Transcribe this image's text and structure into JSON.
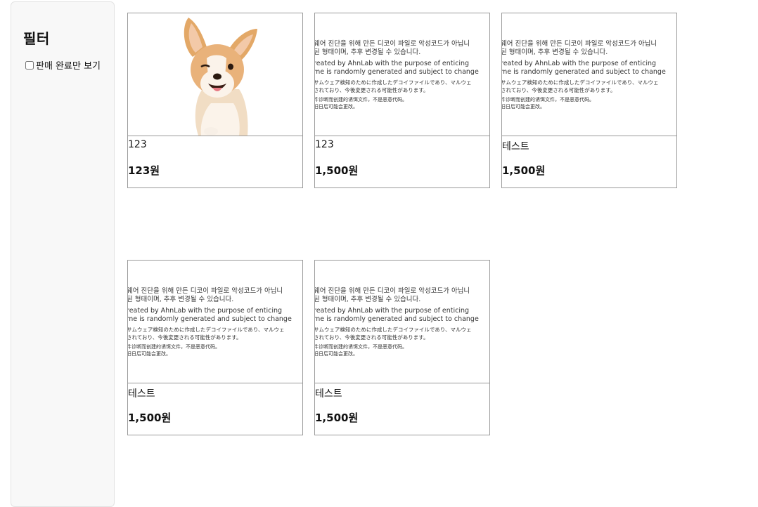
{
  "sidebar": {
    "title": "필터",
    "sold_only_label": "판매 완료만 보기",
    "sold_only_checked": false
  },
  "decoy": {
    "line1a": "웨어 진단을 위해 만든 디코이 파일로 악성코드가 아닙니",
    "line1b": "된 형태이며, 추후 변경될 수 있습니다.",
    "line2a": "reated by AhnLab with the purpose of enticing",
    "line2b": "me is randomly generated and subject to change",
    "line3a": "サムウェア検知のために作成したデコイファイルであり、マルウェ",
    "line3b": "されており、今後変更される可能性があります。",
    "line4a": "件诊断而创建的诱饵文件，不是恶意代码。",
    "line4b": "旧日后可能会更改。"
  },
  "products": [
    {
      "title": "123",
      "price": "123원",
      "image": "corgi-dog-photo"
    },
    {
      "title": "123",
      "price": "1,500원",
      "image": "decoy-text-image"
    },
    {
      "title": "테스트",
      "price": "1,500원",
      "image": "decoy-text-image"
    },
    {
      "title": "테스트",
      "price": "1,500원",
      "image": "decoy-text-image"
    },
    {
      "title": "테스트",
      "price": "1,500원",
      "image": "decoy-text-image"
    }
  ]
}
